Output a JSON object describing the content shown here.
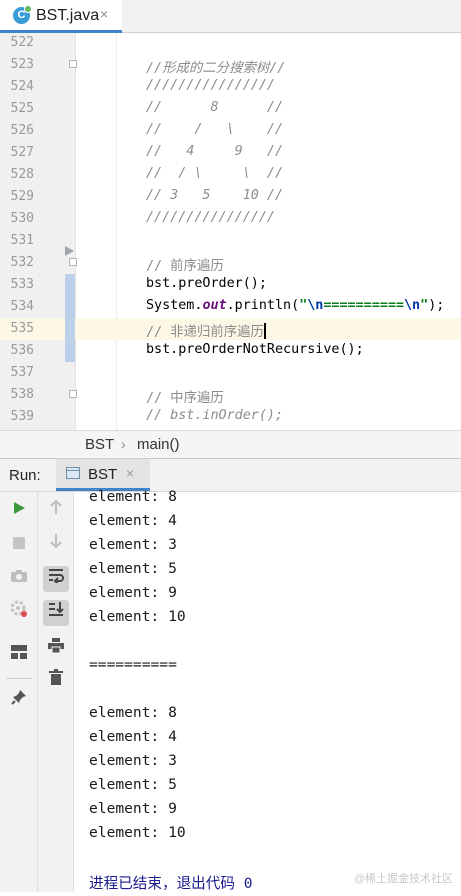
{
  "tab": {
    "icon_letter": "C",
    "label": "BST.java",
    "close": "×"
  },
  "editor": {
    "lines": [
      {
        "num": "522",
        "code": []
      },
      {
        "num": "523",
        "code": [
          {
            "t": "//形成的二分搜索树//",
            "c": "c-comment"
          }
        ]
      },
      {
        "num": "524",
        "code": [
          {
            "t": "////////////////",
            "c": "c-comment"
          }
        ]
      },
      {
        "num": "525",
        "code": [
          {
            "t": "//      8      //",
            "c": "c-comment"
          }
        ]
      },
      {
        "num": "526",
        "code": [
          {
            "t": "//    /   \\    //",
            "c": "c-comment"
          }
        ]
      },
      {
        "num": "527",
        "code": [
          {
            "t": "//   4     9   //",
            "c": "c-comment"
          }
        ]
      },
      {
        "num": "528",
        "code": [
          {
            "t": "//  / \\     \\  //",
            "c": "c-comment"
          }
        ]
      },
      {
        "num": "529",
        "code": [
          {
            "t": "// 3   5    10 //",
            "c": "c-comment"
          }
        ]
      },
      {
        "num": "530",
        "code": [
          {
            "t": "////////////////",
            "c": "c-comment"
          }
        ]
      },
      {
        "num": "531",
        "code": []
      },
      {
        "num": "532",
        "code": [
          {
            "t": "// 前序遍历",
            "c": "c-comment-n"
          }
        ]
      },
      {
        "num": "533",
        "code": [
          {
            "t": "bst.preOrder();",
            "c": ""
          }
        ]
      },
      {
        "num": "534",
        "code": [
          {
            "t": "System.",
            "c": ""
          },
          {
            "t": "out",
            "c": "c-field"
          },
          {
            "t": ".println(",
            "c": ""
          },
          {
            "t": "\"",
            "c": "c-str"
          },
          {
            "t": "\\n",
            "c": "c-esc"
          },
          {
            "t": "==========",
            "c": "c-str"
          },
          {
            "t": "\\n",
            "c": "c-esc"
          },
          {
            "t": "\"",
            "c": "c-str"
          },
          {
            "t": ");",
            "c": ""
          }
        ]
      },
      {
        "num": "535",
        "code": [
          {
            "t": "// 非递归前序遍历",
            "c": "c-comment-n"
          }
        ]
      },
      {
        "num": "536",
        "code": [
          {
            "t": "bst.preOrderNotRecursive();",
            "c": ""
          }
        ]
      },
      {
        "num": "537",
        "code": []
      },
      {
        "num": "538",
        "code": [
          {
            "t": "// 中序遍历",
            "c": "c-comment-n"
          }
        ]
      },
      {
        "num": "539",
        "code": [
          {
            "t": "// bst.inOrder();",
            "c": "c-comment"
          }
        ]
      }
    ],
    "current_line": "535"
  },
  "breadcrumb": {
    "class_name": "BST",
    "separator": "›",
    "method": "main()"
  },
  "run": {
    "label": "Run:",
    "tab_label": "BST",
    "tab_close": "×",
    "console_lines": [
      "element: 8",
      "element: 4",
      "element: 3",
      "element: 5",
      "element: 9",
      "element: 10",
      "",
      "==========",
      "",
      "element: 8",
      "element: 4",
      "element: 3",
      "element: 5",
      "element: 9",
      "element: 10",
      "",
      "进程已结束，退出代码 0"
    ],
    "toolbar_left": [
      "run-icon",
      "stop-icon",
      "camera-icon",
      "settings-icon",
      "layout-icon",
      "pin-icon"
    ],
    "toolbar_right": [
      "up-arrow-icon",
      "down-arrow-icon",
      "soft-wrap-icon",
      "scroll-to-end-icon",
      "print-icon",
      "trash-icon"
    ]
  },
  "watermark": "@稀土掘金技术社区",
  "colors": {
    "accent": "#4083c9",
    "current_line": "#fdf8e6",
    "comment": "#8c8c8c",
    "string": "#067d17",
    "field": "#660e7a",
    "run_green": "#3c9a3c"
  }
}
